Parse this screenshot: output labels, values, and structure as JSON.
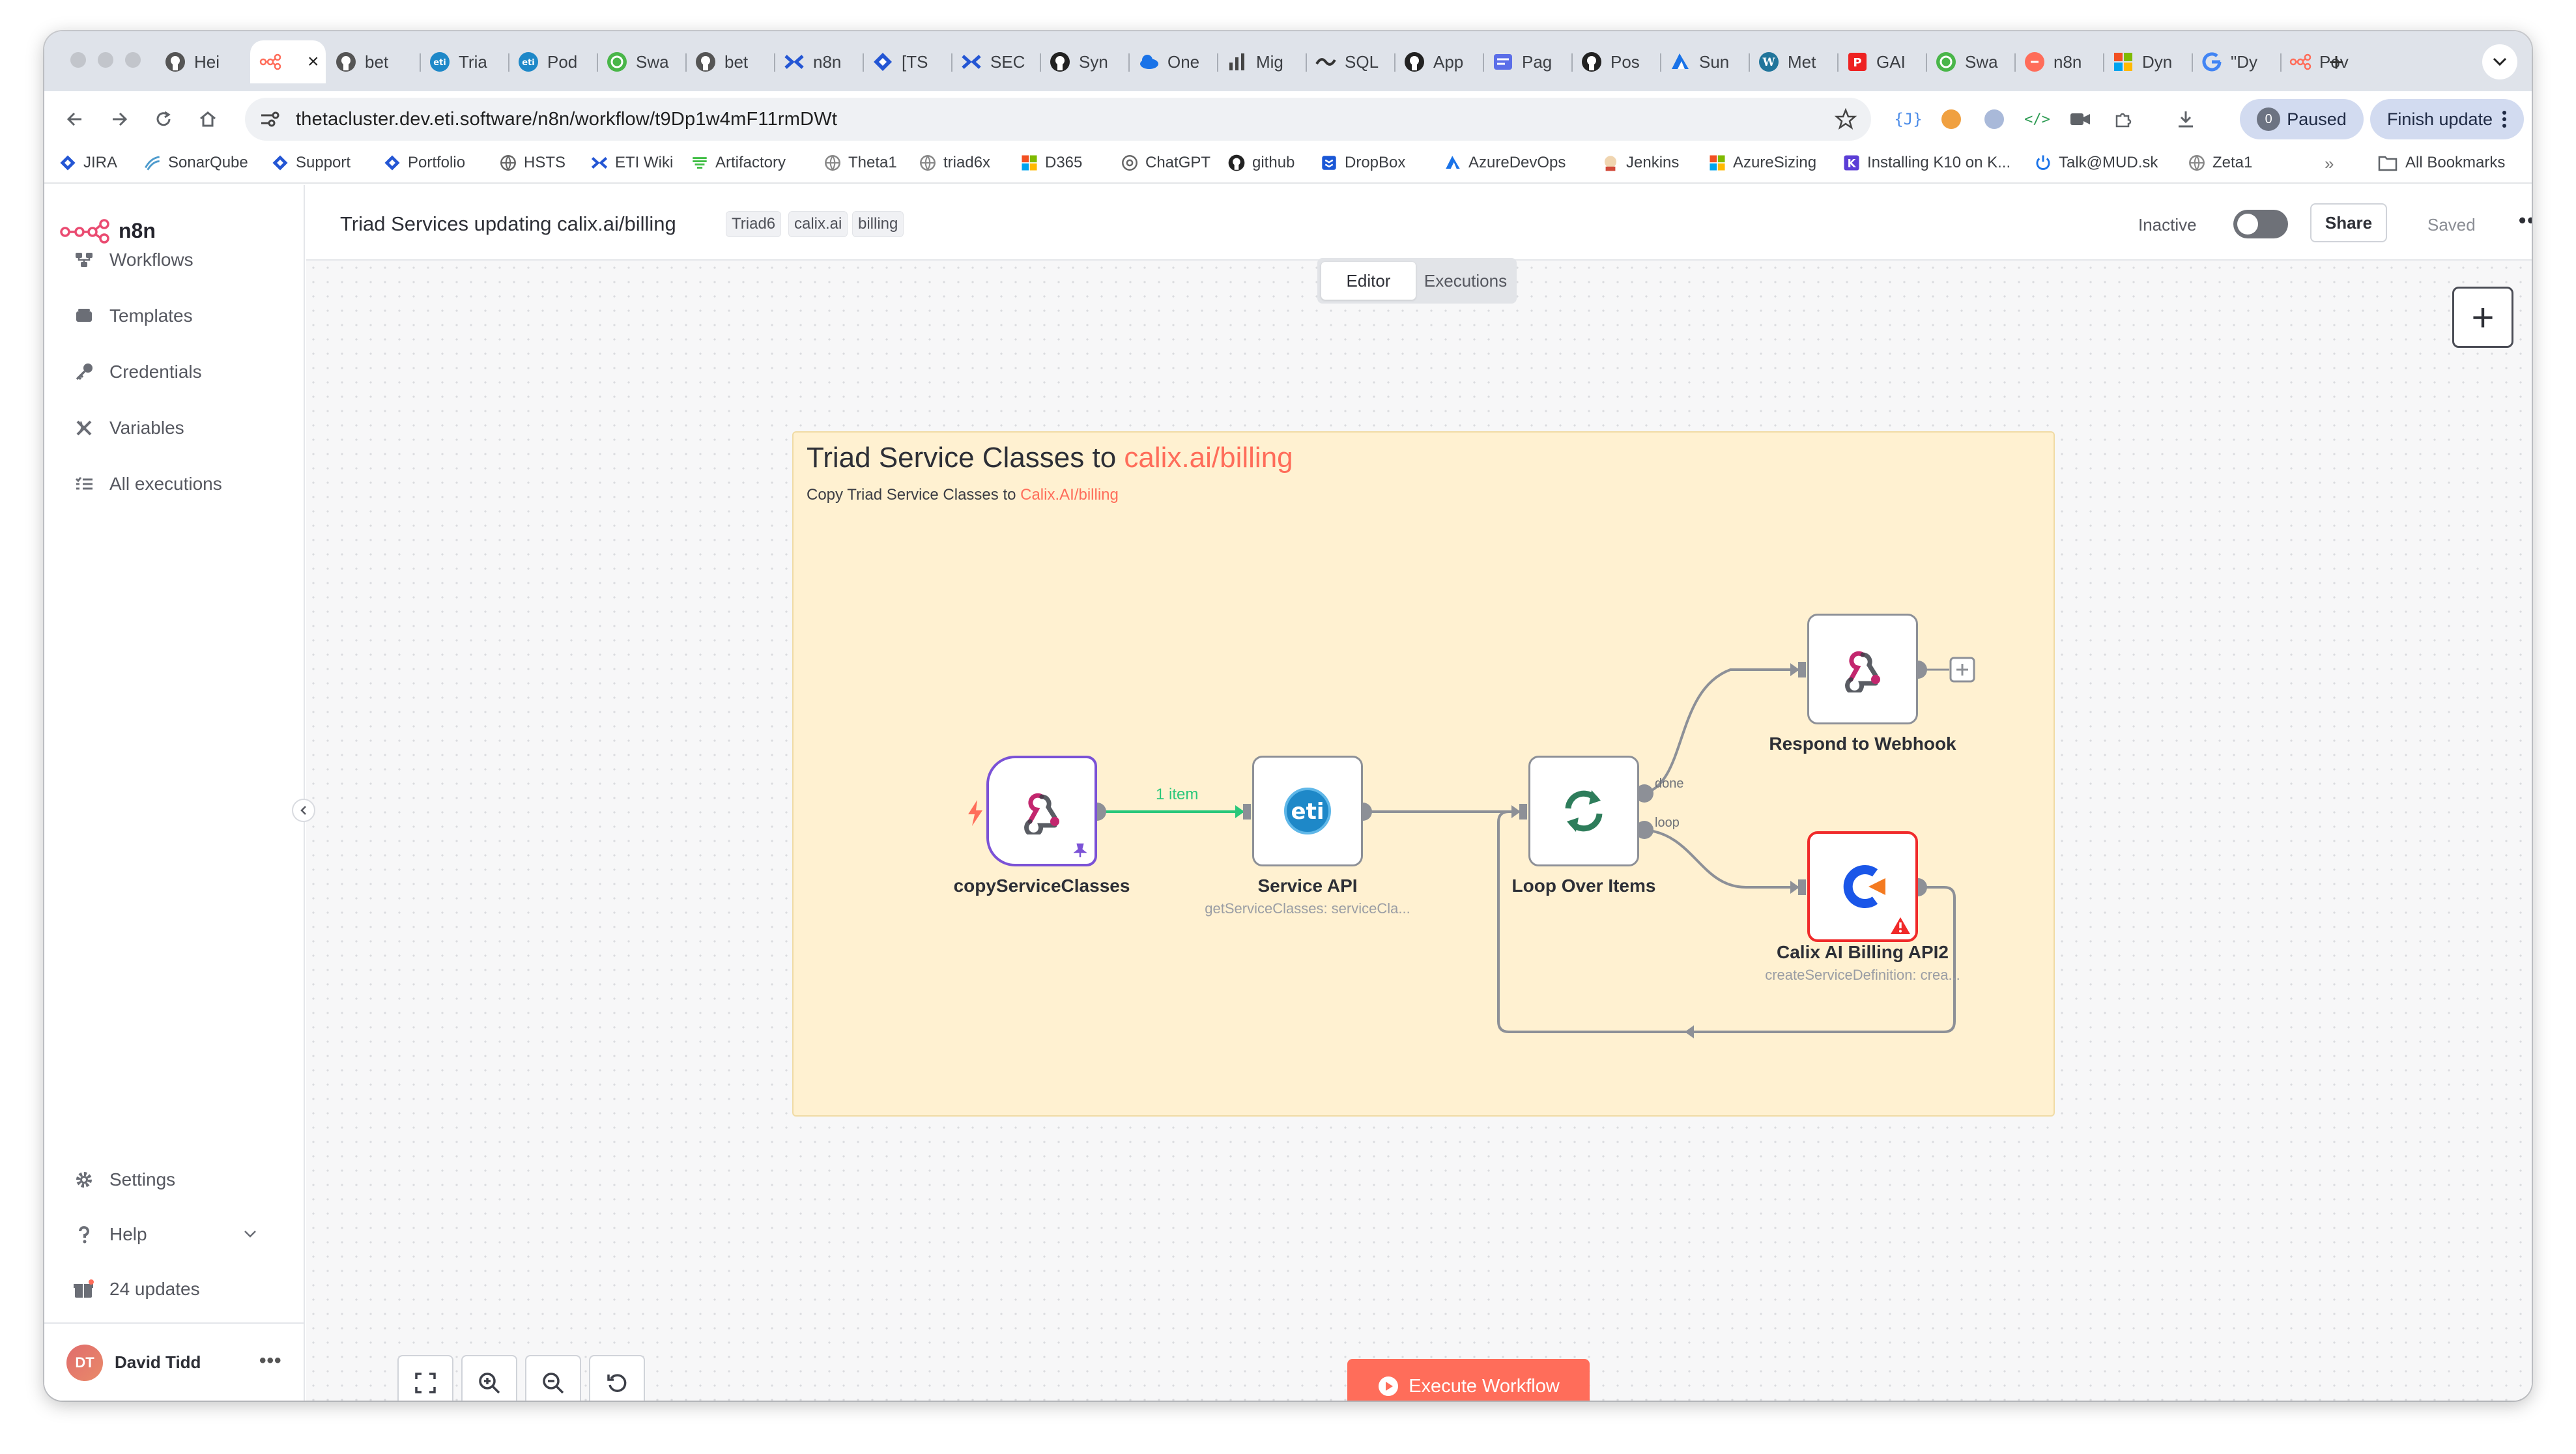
{
  "browser": {
    "tabs": [
      {
        "title": "Hei",
        "icon": "github-icon",
        "color": "#555"
      },
      {
        "title": "",
        "icon": "n8n-icon",
        "color": "#ff6d5a",
        "active": true
      },
      {
        "title": "bet",
        "icon": "github-icon",
        "color": "#555"
      },
      {
        "title": "Tria",
        "icon": "eti-icon",
        "color": "#1e88c8"
      },
      {
        "title": "Pod",
        "icon": "eti-icon",
        "color": "#1e88c8"
      },
      {
        "title": "Swa",
        "icon": "swagger-icon",
        "color": "#49b649"
      },
      {
        "title": "bet",
        "icon": "github-icon",
        "color": "#555"
      },
      {
        "title": "n8n",
        "icon": "confluence-icon",
        "color": "#2456d4"
      },
      {
        "title": "[TS",
        "icon": "jira-icon",
        "color": "#2456d4"
      },
      {
        "title": "SEC",
        "icon": "confluence-icon",
        "color": "#2456d4"
      },
      {
        "title": "Syn",
        "icon": "github-icon",
        "color": "#222"
      },
      {
        "title": "One",
        "icon": "onedrive-icon",
        "color": "#1a73e8"
      },
      {
        "title": "Mig",
        "icon": "chart-icon",
        "color": "#444"
      },
      {
        "title": "SQL",
        "icon": "sql-icon",
        "color": "#333"
      },
      {
        "title": "App",
        "icon": "github-icon",
        "color": "#222"
      },
      {
        "title": "Pag",
        "icon": "pages-icon",
        "color": "#5b6ee8"
      },
      {
        "title": "Pos",
        "icon": "github-icon",
        "color": "#222"
      },
      {
        "title": "Sun",
        "icon": "azure-icon",
        "color": "#1a73e8"
      },
      {
        "title": "Met",
        "icon": "wordpress-icon",
        "color": "#21759b"
      },
      {
        "title": "GAI",
        "icon": "pdf-icon",
        "color": "#e22"
      },
      {
        "title": "Swa",
        "icon": "swagger-icon",
        "color": "#49b649"
      },
      {
        "title": "n8n",
        "icon": "orange-icon",
        "color": "#ff6d5a"
      },
      {
        "title": "Dyn",
        "icon": "microsoft-icon",
        "color": "#f25022"
      },
      {
        "title": "\"Dy",
        "icon": "google-icon",
        "color": "#4285f4"
      },
      {
        "title": "Pov",
        "icon": "n8n-icon",
        "color": "#ff6d5a"
      }
    ],
    "url": "thetacluster.dev.eti.software/n8n/workflow/t9Dp1w4mF11rmDWt",
    "paused_count": "0",
    "paused_label": "Paused",
    "finish_update_label": "Finish update",
    "bookmarks": [
      {
        "label": "JIRA",
        "icon": "jira-icon",
        "color": "#2456d4"
      },
      {
        "label": "SonarQube",
        "icon": "sonarqube-icon",
        "color": "#4e9bcd"
      },
      {
        "label": "Support",
        "icon": "jira-icon",
        "color": "#2456d4"
      },
      {
        "label": "Portfolio",
        "icon": "jira-icon",
        "color": "#2456d4"
      },
      {
        "label": "HSTS",
        "icon": "globe-icon",
        "color": "#666"
      },
      {
        "label": "ETI Wiki",
        "icon": "confluence-icon",
        "color": "#2456d4"
      },
      {
        "label": "Artifactory",
        "icon": "artifactory-icon",
        "color": "#40be46"
      },
      {
        "label": "Theta1",
        "icon": "globe-icon",
        "color": "#888"
      },
      {
        "label": "triad6x",
        "icon": "globe-icon",
        "color": "#888"
      },
      {
        "label": "D365",
        "icon": "microsoft-icon",
        "color": "#f25022"
      },
      {
        "label": "ChatGPT",
        "icon": "chatgpt-icon",
        "color": "#666"
      },
      {
        "label": "github",
        "icon": "github-icon",
        "color": "#222"
      },
      {
        "label": "DropBox",
        "icon": "dropbox-icon",
        "color": "#1a57d6"
      },
      {
        "label": "AzureDevOps",
        "icon": "azure-icon",
        "color": "#1a73e8"
      },
      {
        "label": "Jenkins",
        "icon": "jenkins-icon",
        "color": "#d24939"
      },
      {
        "label": "AzureSizing",
        "icon": "microsoft-icon",
        "color": "#f25022"
      },
      {
        "label": "Installing K10 on K...",
        "icon": "k-icon",
        "color": "#5b3ed6"
      },
      {
        "label": "Talk@MUD.sk",
        "icon": "power-icon",
        "color": "#1a73e8"
      },
      {
        "label": "Zeta1",
        "icon": "globe-icon",
        "color": "#888"
      }
    ],
    "all_bookmarks_label": "All Bookmarks"
  },
  "sidebar": {
    "logo_text": "n8n",
    "items": [
      {
        "label": "Workflows",
        "icon": "workflows-icon"
      },
      {
        "label": "Templates",
        "icon": "templates-icon"
      },
      {
        "label": "Credentials",
        "icon": "key-icon"
      },
      {
        "label": "Variables",
        "icon": "variables-icon"
      },
      {
        "label": "All executions",
        "icon": "list-icon"
      }
    ],
    "bottom": [
      {
        "label": "Settings",
        "icon": "gear-icon"
      },
      {
        "label": "Help",
        "icon": "question-icon"
      },
      {
        "label": "24 updates",
        "icon": "gift-icon"
      }
    ],
    "user": {
      "initials": "DT",
      "name": "David Tidd"
    }
  },
  "header": {
    "title": "Triad Services updating calix.ai/billing",
    "tags": [
      "Triad6",
      "calix.ai",
      "billing"
    ],
    "inactive_label": "Inactive",
    "share_label": "Share",
    "saved_label": "Saved",
    "tabs": [
      {
        "label": "Editor",
        "active": true
      },
      {
        "label": "Executions",
        "active": false
      }
    ]
  },
  "sticky": {
    "title_prefix": "Triad Service Classes to ",
    "title_highlight": "calix.ai/billing",
    "subtitle_prefix": "Copy Triad Service Classes to ",
    "subtitle_highlight": "Calix.AI/billing"
  },
  "nodes": {
    "trigger": {
      "label": "copyServiceClasses"
    },
    "service_api": {
      "label": "Service API",
      "sub": "getServiceClasses: serviceCla..."
    },
    "loop": {
      "label": "Loop Over Items",
      "port_done": "done",
      "port_loop": "loop"
    },
    "respond": {
      "label": "Respond to Webhook"
    },
    "calix": {
      "label": "Calix AI Billing API2",
      "sub": "createServiceDefinition: crea..."
    }
  },
  "connection_label": "1 item",
  "execute_label": "Execute Workflow"
}
